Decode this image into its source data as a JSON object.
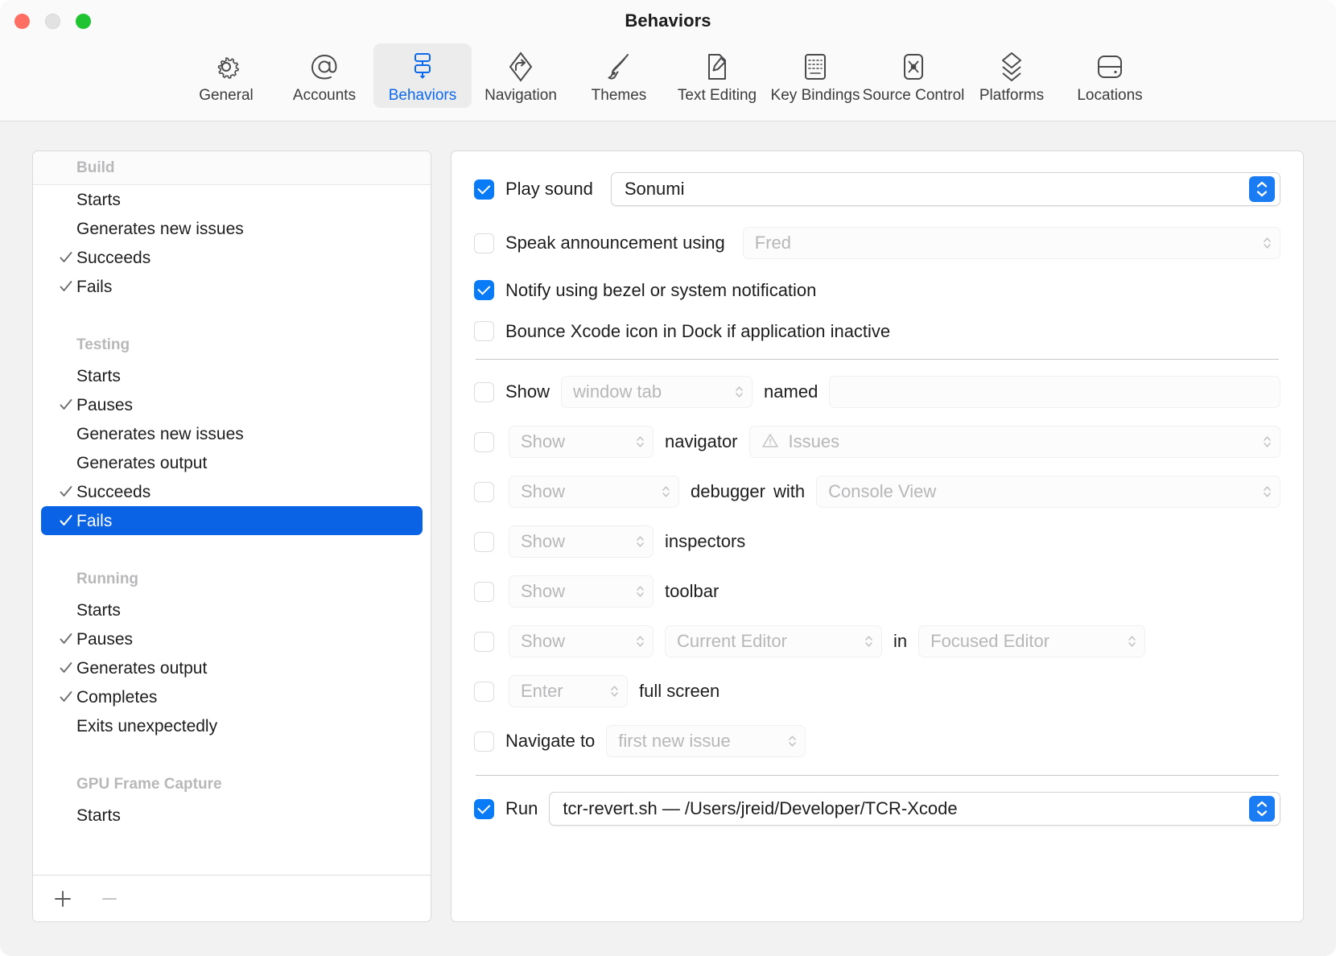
{
  "window": {
    "title": "Behaviors",
    "traffic_lights": [
      "close",
      "minimize",
      "zoom"
    ]
  },
  "toolbar": {
    "items": [
      {
        "label": "General",
        "icon": "gear-icon",
        "active": false
      },
      {
        "label": "Accounts",
        "icon": "at-sign-icon",
        "active": false
      },
      {
        "label": "Behaviors",
        "icon": "behaviors-icon",
        "active": true
      },
      {
        "label": "Navigation",
        "icon": "navigation-arrow-icon",
        "active": false
      },
      {
        "label": "Themes",
        "icon": "paintbrush-icon",
        "active": false
      },
      {
        "label": "Text Editing",
        "icon": "text-edit-icon",
        "active": false
      },
      {
        "label": "Key Bindings",
        "icon": "keyboard-icon",
        "active": false
      },
      {
        "label": "Source Control",
        "icon": "source-control-icon",
        "active": false
      },
      {
        "label": "Platforms",
        "icon": "layers-icon",
        "active": false
      },
      {
        "label": "Locations",
        "icon": "drive-icon",
        "active": false
      }
    ]
  },
  "sidebar": {
    "groups": [
      {
        "title": "Build",
        "items": [
          {
            "label": "Starts",
            "checked": false,
            "selected": false
          },
          {
            "label": "Generates new issues",
            "checked": false,
            "selected": false
          },
          {
            "label": "Succeeds",
            "checked": true,
            "selected": false
          },
          {
            "label": "Fails",
            "checked": true,
            "selected": false
          }
        ]
      },
      {
        "title": "Testing",
        "items": [
          {
            "label": "Starts",
            "checked": false,
            "selected": false
          },
          {
            "label": "Pauses",
            "checked": true,
            "selected": false
          },
          {
            "label": "Generates new issues",
            "checked": false,
            "selected": false
          },
          {
            "label": "Generates output",
            "checked": false,
            "selected": false
          },
          {
            "label": "Succeeds",
            "checked": true,
            "selected": false
          },
          {
            "label": "Fails",
            "checked": true,
            "selected": true
          }
        ]
      },
      {
        "title": "Running",
        "items": [
          {
            "label": "Starts",
            "checked": false,
            "selected": false
          },
          {
            "label": "Pauses",
            "checked": true,
            "selected": false
          },
          {
            "label": "Generates output",
            "checked": true,
            "selected": false
          },
          {
            "label": "Completes",
            "checked": true,
            "selected": false
          },
          {
            "label": "Exits unexpectedly",
            "checked": false,
            "selected": false
          }
        ]
      },
      {
        "title": "GPU Frame Capture",
        "items": [
          {
            "label": "Starts",
            "checked": false,
            "selected": false
          }
        ]
      }
    ],
    "footer": {
      "add_label": "+",
      "remove_label": "−"
    }
  },
  "detail": {
    "play_sound": {
      "label": "Play sound",
      "checked": true,
      "value": "Sonumi"
    },
    "speak": {
      "label": "Speak announcement using",
      "checked": false,
      "value": "Fred"
    },
    "notify": {
      "label": "Notify using bezel or system notification",
      "checked": true
    },
    "bounce": {
      "label": "Bounce Xcode icon in Dock if application inactive",
      "checked": false
    },
    "show_tab": {
      "checked": false,
      "label": "Show",
      "target": "window tab",
      "named_label": "named",
      "name_value": ""
    },
    "navigator": {
      "checked": false,
      "action": "Show",
      "label": "navigator",
      "value": "Issues",
      "value_icon": "warning-triangle-icon"
    },
    "debugger": {
      "checked": false,
      "action": "Show",
      "label": "debugger",
      "with_label": "with",
      "value": "Console View"
    },
    "inspectors": {
      "checked": false,
      "action": "Show",
      "label": "inspectors"
    },
    "toolbar_row": {
      "checked": false,
      "action": "Show",
      "label": "toolbar"
    },
    "editor": {
      "checked": false,
      "action": "Show",
      "editor": "Current Editor",
      "in_label": "in",
      "target": "Focused Editor"
    },
    "full_screen": {
      "checked": false,
      "action": "Enter",
      "label": "full screen"
    },
    "navigate": {
      "checked": false,
      "label": "Navigate to",
      "value": "first new issue"
    },
    "run": {
      "checked": true,
      "label": "Run",
      "value": "tcr-revert.sh — /Users/jreid/Developer/TCR-Xcode"
    }
  },
  "colors": {
    "accent_blue": "#0a7bf7",
    "selection_blue": "#0a62e4",
    "stepper_blue": "#1a7bf2",
    "label_dim": "#b7b7ba",
    "group_header": "#b8b8bb"
  }
}
